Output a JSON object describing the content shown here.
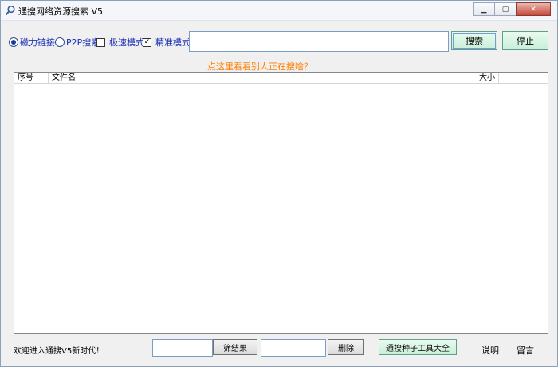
{
  "window": {
    "title": "通搜网络资源搜索 V5"
  },
  "options": {
    "radio_magnet": "磁力链接",
    "radio_p2p": "P2P搜索",
    "check_fast": "极速模式",
    "check_precise": "精准模式",
    "radio_magnet_selected": true,
    "check_fast_checked": false,
    "check_precise_checked": true
  },
  "search": {
    "value": "",
    "search_button": "搜索",
    "stop_button": "停止"
  },
  "hint_link": "点这里看看别人正在搜啥？",
  "table": {
    "columns": [
      "序号",
      "文件名",
      "大小"
    ],
    "rows": []
  },
  "status": {
    "message": "欢迎进入通搜V5新时代！",
    "filter_value": "",
    "filter_button": "筛结果",
    "delete_value": "",
    "delete_button": "删除",
    "tools_button": "通搜种子工具大全",
    "help_link": "说明",
    "message_link": "留言"
  }
}
